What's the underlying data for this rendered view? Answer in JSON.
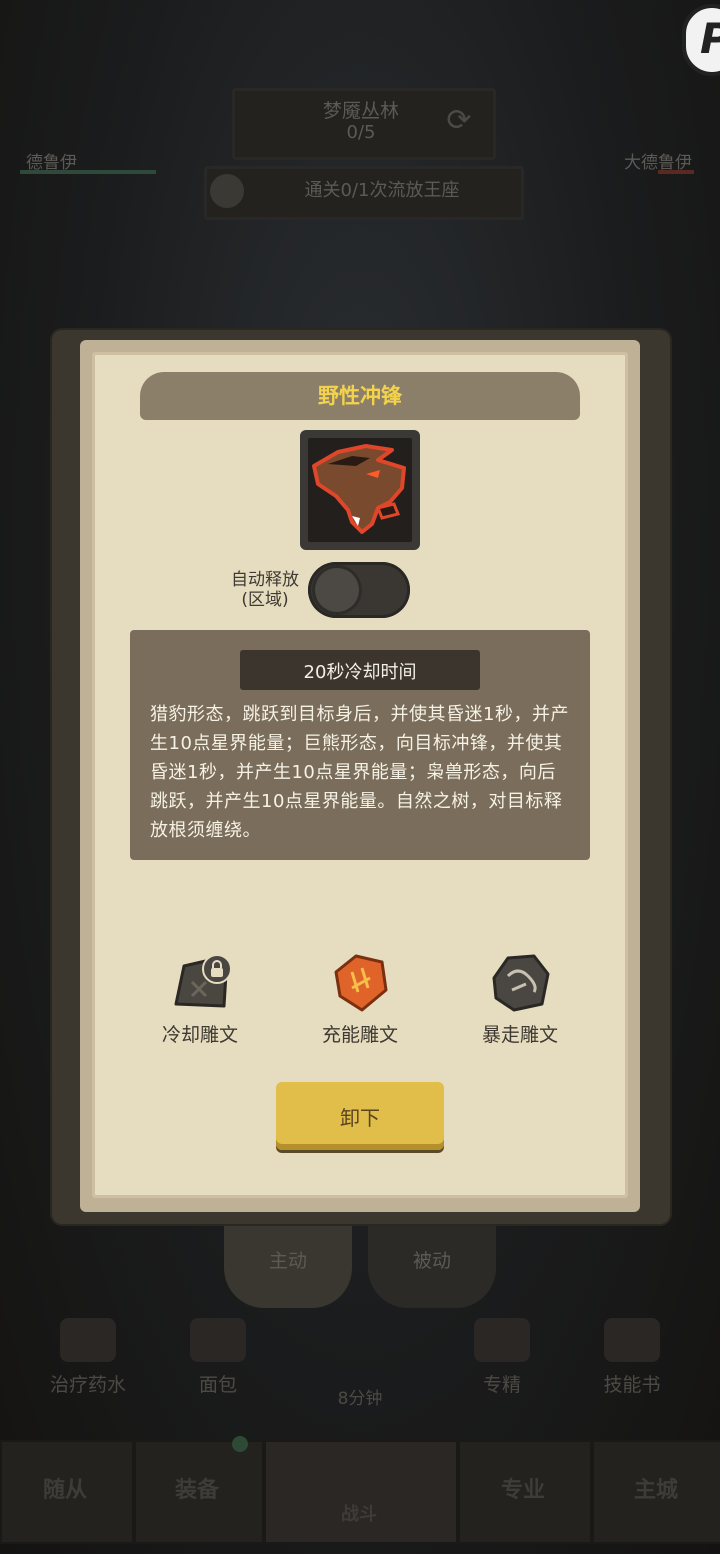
{
  "background": {
    "zone": {
      "name": "梦魇丛林",
      "progress": "0/5"
    },
    "left_class": "德鲁伊",
    "right_class": "大德鲁伊",
    "quest": "通关0/1次流放王座",
    "tabs": [
      "主动",
      "被动"
    ],
    "items": [
      "治疗药水",
      "面包",
      "专精",
      "技能书"
    ],
    "timer": "8分钟",
    "nav": [
      "随从",
      "装备",
      "战斗",
      "专业",
      "主城"
    ]
  },
  "dialog": {
    "title": "野性冲锋",
    "auto_cast_label": "自动释放",
    "auto_cast_sub": "(区域)",
    "auto_cast_on": false,
    "cooldown": "20秒冷却时间",
    "description": "猎豹形态，跳跃到目标身后，并使其昏迷1秒，并产生10点星界能量；巨熊形态，向目标冲锋，并使其昏迷1秒，并产生10点星界能量；枭兽形态，向后跳跃，并产生10点星界能量。自然之树，对目标释放根须缠绕。",
    "runes": [
      {
        "label": "冷却雕文",
        "icon": "cooldown-rune-icon",
        "locked": true
      },
      {
        "label": "充能雕文",
        "icon": "charge-rune-icon",
        "locked": false
      },
      {
        "label": "暴走雕文",
        "icon": "rampage-rune-icon",
        "locked": false
      }
    ],
    "unequip": "卸下"
  },
  "colors": {
    "title": "#f3d34c",
    "button": "#e0be49",
    "panel": "#e6dcbf",
    "desc_box": "#7a6d5b"
  }
}
